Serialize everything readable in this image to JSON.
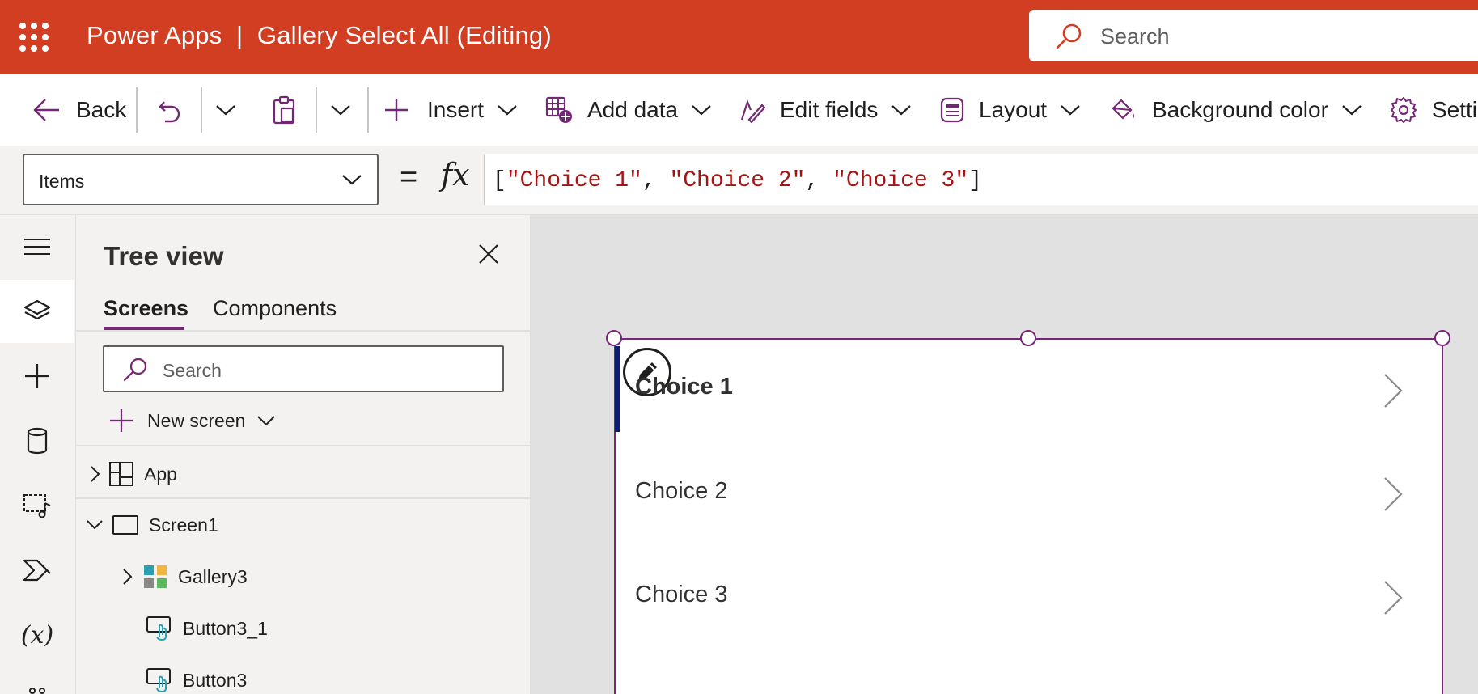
{
  "header": {
    "app_title": "Power Apps  |  Gallery Select All (Editing)",
    "search_placeholder": "Search",
    "brand_color": "#d13e22"
  },
  "commandbar": {
    "back_label": "Back",
    "insert_label": "Insert",
    "add_data_label": "Add data",
    "edit_fields_label": "Edit fields",
    "layout_label": "Layout",
    "background_color_label": "Background color",
    "settings_label": "Setti"
  },
  "formulabar": {
    "property": "Items",
    "equals": "=",
    "fx": "fx",
    "formula": {
      "open": "[",
      "item1": "\"Choice 1\"",
      "sep1": ", ",
      "item2": "\"Choice 2\"",
      "sep2": ", ",
      "item3": "\"Choice 3\"",
      "close": "]"
    }
  },
  "rail": {
    "items": [
      "hamburger-icon",
      "layers-icon",
      "plus-icon",
      "database-icon",
      "media-icon",
      "power-automate-icon",
      "variables-icon"
    ],
    "variables_glyph": "(x)"
  },
  "tree": {
    "title": "Tree view",
    "tabs": [
      {
        "label": "Screens",
        "active": true
      },
      {
        "label": "Components",
        "active": false
      }
    ],
    "search_placeholder": "Search",
    "new_screen_label": "New screen",
    "nodes": [
      {
        "label": "App",
        "expandable": true,
        "expanded": false
      },
      {
        "label": "Screen1",
        "expandable": true,
        "expanded": true
      },
      {
        "label": "Gallery3",
        "expandable": true,
        "expanded": false
      },
      {
        "label": "Button3_1",
        "expandable": false
      },
      {
        "label": "Button3",
        "expandable": false
      }
    ],
    "accent_color": "#742774"
  },
  "canvas": {
    "gallery_rows": [
      {
        "label": "Choice 1",
        "selected": true
      },
      {
        "label": "Choice 2",
        "selected": false
      },
      {
        "label": "Choice 3",
        "selected": false
      }
    ]
  }
}
